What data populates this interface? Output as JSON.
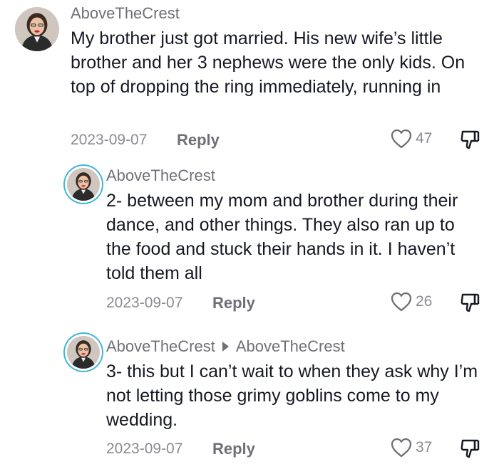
{
  "comments": [
    {
      "username": "AboveTheCrest",
      "text": "My brother just got married. His new wife’s little brother and her 3 nephews were the only kids. On top of dropping the ring immediately, running in",
      "date": "2023-09-07",
      "reply_label": "Reply",
      "likes": "47"
    },
    {
      "username": "AboveTheCrest",
      "text": "2- between my mom and brother during their dance, and other things. They also ran up to the food and stuck their hands in it. I haven’t told them all",
      "date": "2023-09-07",
      "reply_label": "Reply",
      "likes": "26"
    },
    {
      "username": "AboveTheCrest",
      "reply_to": "AboveTheCrest",
      "text": "3- this but I can’t wait to when they ask why I’m not letting those grimy goblins come to my wedding.",
      "date": "2023-09-07",
      "reply_label": "Reply",
      "likes": "37"
    }
  ]
}
